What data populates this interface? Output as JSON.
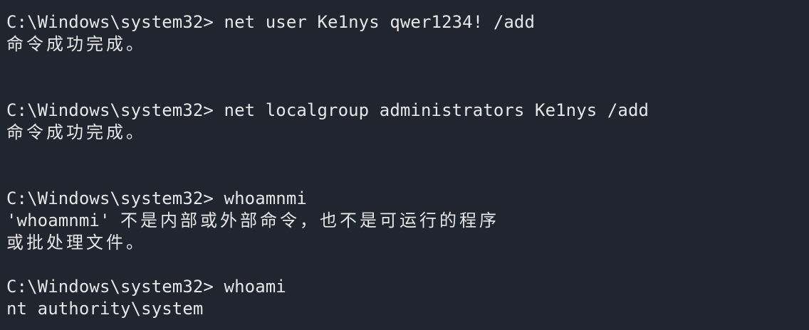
{
  "terminal": {
    "prompt": "C:\\Windows\\system32> ",
    "blocks": [
      {
        "command": "net user Ke1nys qwer1234! /add",
        "output": [
          "命令成功完成。"
        ]
      },
      {
        "command": "net localgroup administrators Ke1nys /add",
        "output": [
          "命令成功完成。"
        ]
      },
      {
        "command": "whoamnmi",
        "output_prefix": "'whoamnmi' ",
        "output_rest": "不是内部或外部命令，也不是可运行的程序",
        "output_line2": "或批处理文件。"
      },
      {
        "command": "whoami",
        "output": [
          "nt authority\\system"
        ]
      }
    ]
  },
  "colors": {
    "background": "#212530",
    "text": "#e6e6e6"
  }
}
